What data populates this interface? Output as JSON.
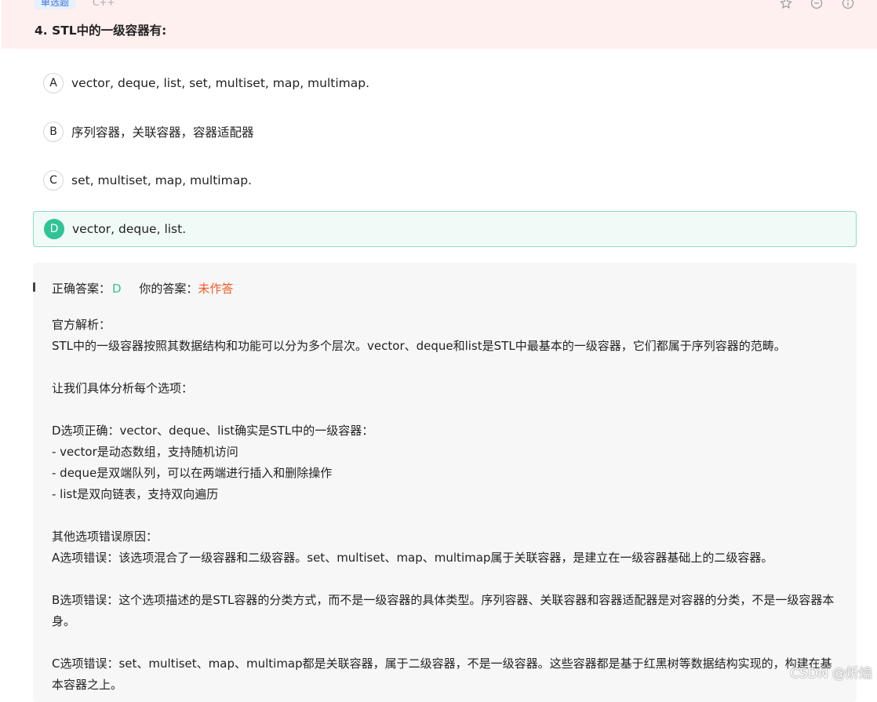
{
  "header": {
    "type_tag": "单选题",
    "lang_tag": "C++",
    "icons": [
      "star-icon",
      "minus-circle-icon",
      "info-icon"
    ],
    "question_title": "4. STL中的一级容器有:"
  },
  "options": [
    {
      "letter": "A",
      "text": "vector, deque, list, set, multiset, map, multimap."
    },
    {
      "letter": "B",
      "text": "序列容器，关联容器，容器适配器"
    },
    {
      "letter": "C",
      "text": "set, multiset, map, multimap."
    },
    {
      "letter": "D",
      "text": "vector, deque, list."
    }
  ],
  "answer": {
    "correct_label": "正确答案：",
    "correct_value": "D",
    "your_label": "你的答案：",
    "your_value": "未作答"
  },
  "analysis": {
    "lines": [
      "官方解析：",
      "STL中的一级容器按照其数据结构和功能可以分为多个层次。vector、deque和list是STL中最基本的一级容器，它们都属于序列容器的范畴。",
      "",
      "让我们具体分析每个选项：",
      "",
      "D选项正确：vector、deque、list确实是STL中的一级容器：",
      "- vector是动态数组，支持随机访问",
      "- deque是双端队列，可以在两端进行插入和删除操作",
      "- list是双向链表，支持双向遍历",
      "",
      "其他选项错误原因：",
      "A选项错误：该选项混合了一级容器和二级容器。set、multiset、map、multimap属于关联容器，是建立在一级容器基础上的二级容器。",
      "",
      "B选项错误：这个选项描述的是STL容器的分类方式，而不是一级容器的具体类型。序列容器、关联容器和容器适配器是对容器的分类，不是一级容器本身。",
      "",
      "C选项错误：set、multiset、map、multimap都是关联容器，属于二级容器，不是一级容器。这些容器都是基于红黑树等数据结构实现的，构建在基本容器之上。"
    ]
  },
  "watermark": "CSDN @炘爚",
  "colors": {
    "header_bg": "#fdf0ee",
    "correct_green": "#30c495",
    "unanswered_orange": "#f05a28",
    "analysis_bg": "#f7f7f7"
  }
}
